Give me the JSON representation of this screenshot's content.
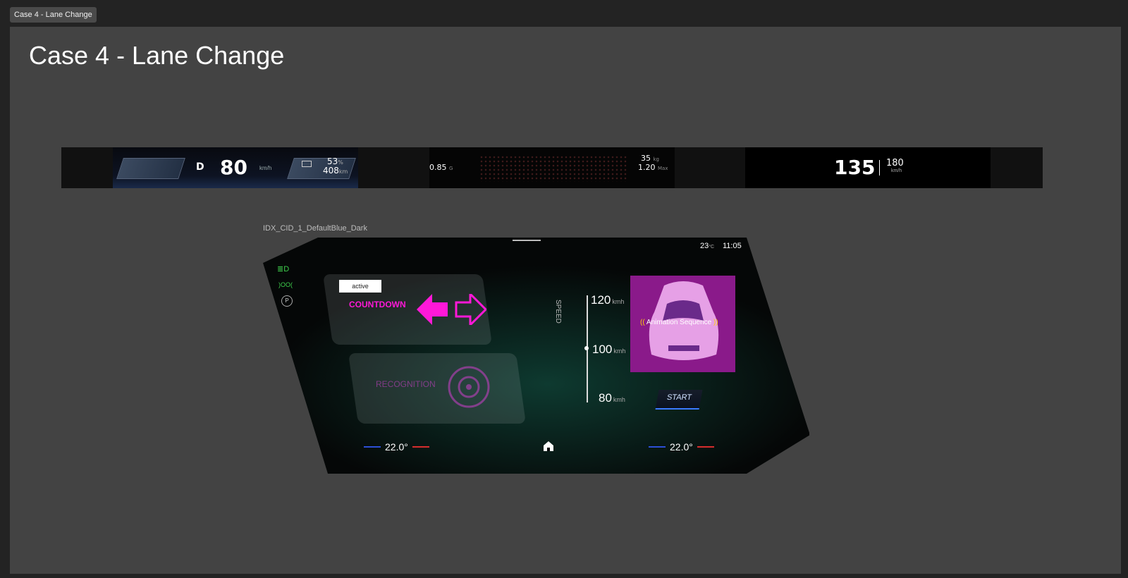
{
  "tab": {
    "label": "Case 4 - Lane Change"
  },
  "page": {
    "title": "Case 4 - Lane Change"
  },
  "cluster": {
    "gear": "D",
    "speed": "80",
    "speed_unit": "km/h",
    "battery_pct": "53",
    "battery_pct_unit": "%",
    "range": "408",
    "range_unit": "km",
    "g_value": "0.85",
    "g_unit": "G",
    "weight": "35",
    "weight_unit": "kg",
    "max_value": "1.20",
    "max_unit": "Max",
    "current_speed": "135",
    "limit_speed": "180",
    "limit_unit": "km/h"
  },
  "cid": {
    "label": "IDX_CID_1_DefaultBlue_Dark",
    "temperature": "23",
    "temperature_unit": "°C",
    "time": "11:05",
    "active_chip": "active",
    "countdown_label": "COUNTDOWN",
    "recognition_label": "RECOGNITION",
    "speed_axis_label": "SPEED",
    "speed_ticks": [
      {
        "value": "120",
        "unit": "kmh"
      },
      {
        "value": "100",
        "unit": "kmh"
      },
      {
        "value": "80",
        "unit": "kmh"
      }
    ],
    "animation_label": "Animation Sequence",
    "start_button": "START",
    "left_temp": "22.0°",
    "right_temp": "22.0°",
    "icons": [
      "headlight-icon",
      "parking-light-icon",
      "parking-brake-icon",
      "left-arrow-icon",
      "right-arrow-icon",
      "steering-wheel-icon",
      "home-icon"
    ],
    "colors": {
      "accent": "#ff18d8",
      "anim_bg": "#8a1a8a",
      "cold": "#2d4fd6",
      "hot": "#d62d2d"
    }
  }
}
